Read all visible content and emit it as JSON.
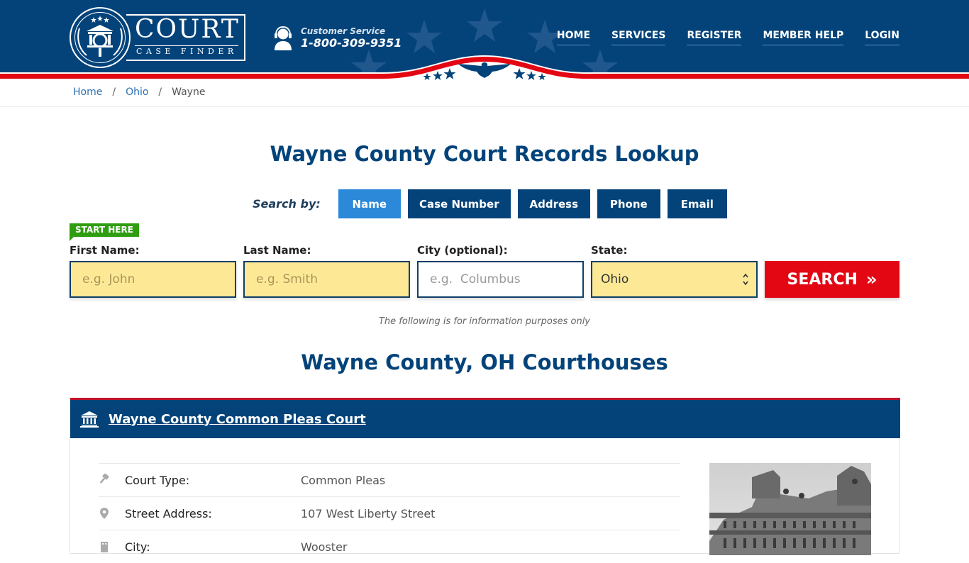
{
  "header": {
    "logo": {
      "title": "COURT",
      "subtitle": "CASE FINDER"
    },
    "customer_service": {
      "label": "Customer Service",
      "phone": "1-800-309-9351"
    },
    "nav": [
      {
        "label": "HOME"
      },
      {
        "label": "SERVICES"
      },
      {
        "label": "REGISTER"
      },
      {
        "label": "MEMBER HELP"
      },
      {
        "label": "LOGIN"
      }
    ]
  },
  "breadcrumb": {
    "items": [
      {
        "label": "Home"
      },
      {
        "label": "Ohio"
      },
      {
        "label": "Wayne"
      }
    ],
    "separator": "/"
  },
  "main": {
    "title": "Wayne County Court Records Lookup",
    "search_by": {
      "label": "Search by:",
      "tabs": [
        {
          "label": "Name",
          "active": true
        },
        {
          "label": "Case Number",
          "active": false
        },
        {
          "label": "Address",
          "active": false
        },
        {
          "label": "Phone",
          "active": false
        },
        {
          "label": "Email",
          "active": false
        }
      ]
    },
    "start_here": "START HERE",
    "form": {
      "first_name": {
        "label": "First Name:",
        "placeholder": "e.g. John",
        "value": ""
      },
      "last_name": {
        "label": "Last Name:",
        "placeholder": "e.g. Smith",
        "value": ""
      },
      "city": {
        "label": "City (optional):",
        "placeholder": "e.g.  Columbus",
        "value": ""
      },
      "state": {
        "label": "State:",
        "selected": "Ohio"
      },
      "search_button": {
        "label": "SEARCH",
        "icon": "»"
      }
    },
    "info_note": "The following is for information purposes only",
    "courthouses_title": "Wayne County, OH Courthouses",
    "courts": [
      {
        "name": "Wayne County Common Pleas Court",
        "details": [
          {
            "icon": "gavel-icon",
            "label": "Court Type:",
            "value": "Common Pleas"
          },
          {
            "icon": "map-pin-icon",
            "label": "Street Address:",
            "value": "107 West Liberty Street"
          },
          {
            "icon": "building-icon",
            "label": "City:",
            "value": "Wooster"
          }
        ]
      }
    ]
  },
  "colors": {
    "brand_blue": "#03437a",
    "accent_red": "#e30613",
    "active_tab": "#2c88d9",
    "input_yellow": "#fde995",
    "start_green": "#2e9d0f"
  }
}
